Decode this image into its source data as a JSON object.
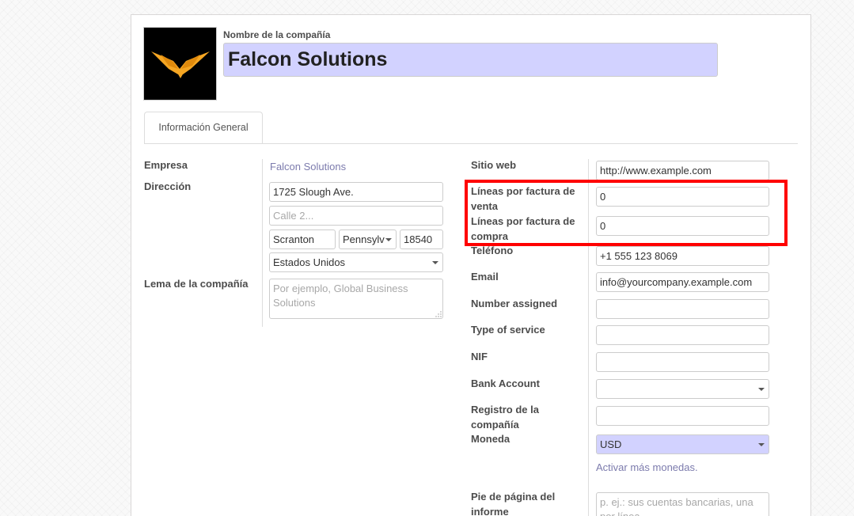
{
  "header": {
    "company_name_label": "Nombre de la compañía",
    "company_name": "Falcon Solutions"
  },
  "tabs": [
    {
      "label": "Información General"
    }
  ],
  "left": {
    "empresa_label": "Empresa",
    "empresa_value": "Falcon Solutions",
    "direccion_label": "Dirección",
    "street": "1725 Slough Ave.",
    "street2_placeholder": "Calle 2...",
    "city": "Scranton",
    "state": "Pennsylv",
    "zip": "18540",
    "country": "Estados Unidos",
    "tagline_label": "Lema de la compañía",
    "tagline_placeholder": "Por ejemplo, Global Business Solutions"
  },
  "right": {
    "website_label": "Sitio web",
    "website": "http://www.example.com",
    "sale_lines_label": "Líneas por factura de venta",
    "sale_lines": "0",
    "purchase_lines_label": "Líneas por factura de compra",
    "purchase_lines": "0",
    "phone_label": "Teléfono",
    "phone": "+1 555 123 8069",
    "email_label": "Email",
    "email": "info@yourcompany.example.com",
    "number_assigned_label": "Number assigned",
    "number_assigned": "",
    "service_type_label": "Type of service",
    "service_type": "",
    "nif_label": "NIF",
    "nif": "",
    "bank_account_label": "Bank Account",
    "bank_account": "",
    "registry_label": "Registro de la compañía",
    "registry": "",
    "currency_label": "Moneda",
    "currency": "USD",
    "activate_currencies_link": "Activar más monedas.",
    "footer_label": "Pie de página del informe",
    "footer_placeholder": "p. ej.: sus cuentas bancarias, una por línea"
  },
  "colors": {
    "highlight_box": "#ff0000",
    "required_field": "#d2d2ff",
    "link": "#7c7bad"
  }
}
